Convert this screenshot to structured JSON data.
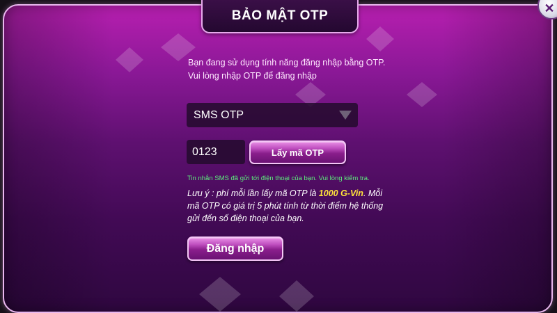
{
  "dialog": {
    "title": "BẢO MẬT OTP",
    "intro_line1": "Bạn đang sử dụng tính năng đăng nhập bằng OTP.",
    "intro_line2": "Vui lòng nhập OTP để đăng nhập",
    "close_icon": "close-icon"
  },
  "otp_method": {
    "selected": "SMS OTP",
    "icon": "chevron-down-icon"
  },
  "otp_input": {
    "value": "0123"
  },
  "buttons": {
    "get_otp": "Lấy mã OTP",
    "login": "Đăng nhập"
  },
  "messages": {
    "sms_sent": "Tin nhắn SMS đã gửi tới điện thoại của bạn. Vui lòng kiểm tra.",
    "note_prefix": "Lưu ý : phí mỗi lần lấy mã OTP là ",
    "note_fee": "1000 G-Vin",
    "note_suffix": ". Mỗi mã OTP có giá trị 5 phút tính từ thời điểm hệ thống gửi đến số điện thoại của bạn."
  },
  "colors": {
    "accent_pink": "#c050c0",
    "success_green": "#5cf07c",
    "fee_yellow": "#ffe43a"
  }
}
